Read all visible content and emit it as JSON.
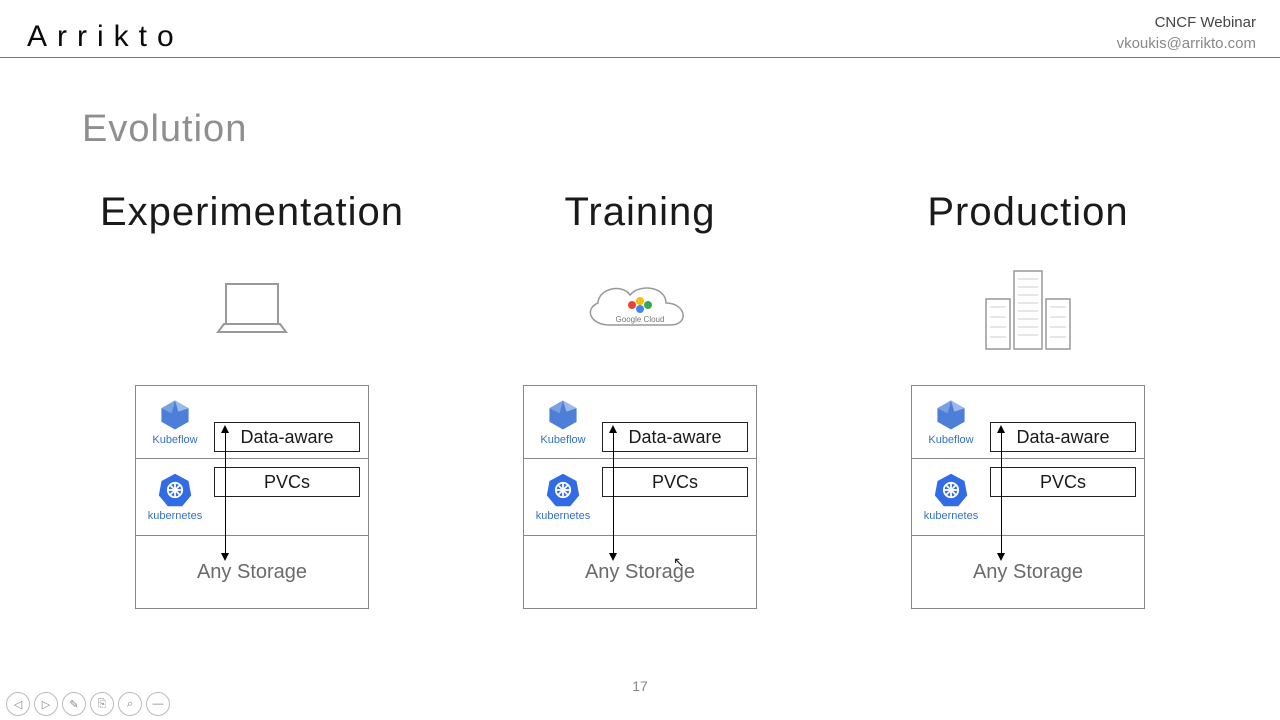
{
  "brand": "Arrikto",
  "meta": {
    "line1": "CNCF Webinar",
    "line2": "vkoukis@arrikto.com"
  },
  "subtitle": "Evolution",
  "page_number": "17",
  "labels": {
    "kubeflow": "Kubeflow",
    "kubernetes": "kubernetes",
    "data_aware": "Data-aware",
    "pvcs": "PVCs",
    "any_storage": "Any Storage",
    "google_cloud": "Google Cloud"
  },
  "columns": [
    {
      "heading": "Experimentation",
      "env": "laptop"
    },
    {
      "heading": "Training",
      "env": "cloud"
    },
    {
      "heading": "Production",
      "env": "datacenter"
    }
  ],
  "controls": [
    "◁",
    "▷",
    "✎",
    "⎘",
    "⌕",
    "—"
  ]
}
